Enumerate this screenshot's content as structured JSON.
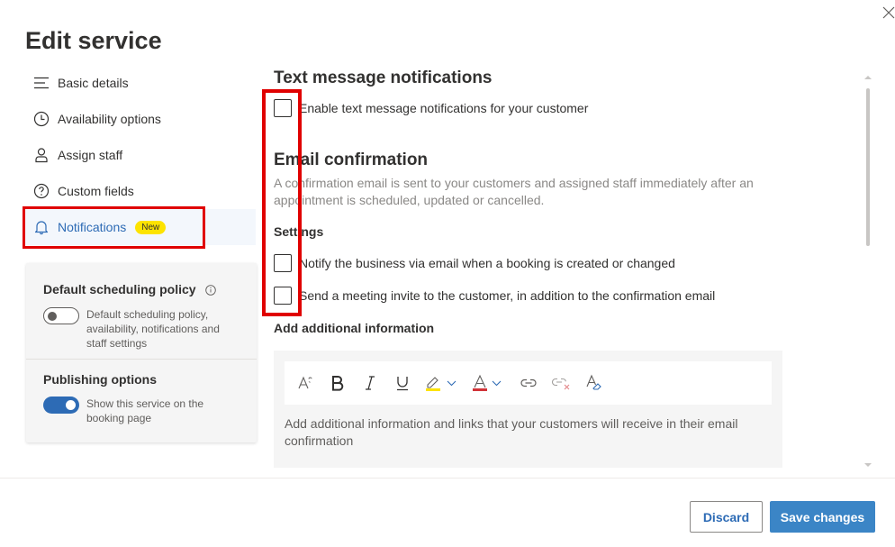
{
  "page_title": "Edit service",
  "nav": {
    "items": [
      {
        "label": "Basic details",
        "icon": "list-icon"
      },
      {
        "label": "Availability options",
        "icon": "clock-icon"
      },
      {
        "label": "Assign staff",
        "icon": "person-icon"
      },
      {
        "label": "Custom fields",
        "icon": "question-circle-icon"
      },
      {
        "label": "Notifications",
        "icon": "bell-icon",
        "badge": "New",
        "selected": true
      }
    ]
  },
  "policy_card": {
    "default_scheduling": {
      "title": "Default scheduling policy",
      "toggle_on": false,
      "toggle_text": "Default scheduling policy, availability, notifications and staff settings"
    },
    "publishing": {
      "title": "Publishing options",
      "toggle_on": true,
      "toggle_text": "Show this service on the booking page"
    }
  },
  "main": {
    "text_notifications": {
      "heading": "Text message notifications",
      "enable_label": "Enable text message notifications for your customer",
      "enable_checked": false
    },
    "email_confirmation": {
      "heading": "Email confirmation",
      "description": "A confirmation email is sent to your customers and assigned staff immediately after an appointment is scheduled, updated or cancelled.",
      "settings_label": "Settings",
      "notify_business_label": "Notify the business via email when a booking is created or changed",
      "notify_business_checked": false,
      "meeting_invite_label": "Send a meeting invite to the customer, in addition to the confirmation email",
      "meeting_invite_checked": false
    },
    "additional_info": {
      "label": "Add additional information",
      "placeholder": "Add additional information and links that your customers will receive in their email confirmation",
      "toolbar": [
        "font-size-icon",
        "bold-icon",
        "italic-icon",
        "underline-icon",
        "highlight-icon",
        "font-color-icon",
        "link-icon",
        "remove-link-icon",
        "clear-formatting-icon"
      ]
    }
  },
  "footer": {
    "discard_label": "Discard",
    "save_label": "Save changes"
  },
  "colors": {
    "accent": "#2d6bb5",
    "primary_button": "#3b85c6",
    "badge": "#fde300",
    "highlight_box": "#e00000"
  }
}
